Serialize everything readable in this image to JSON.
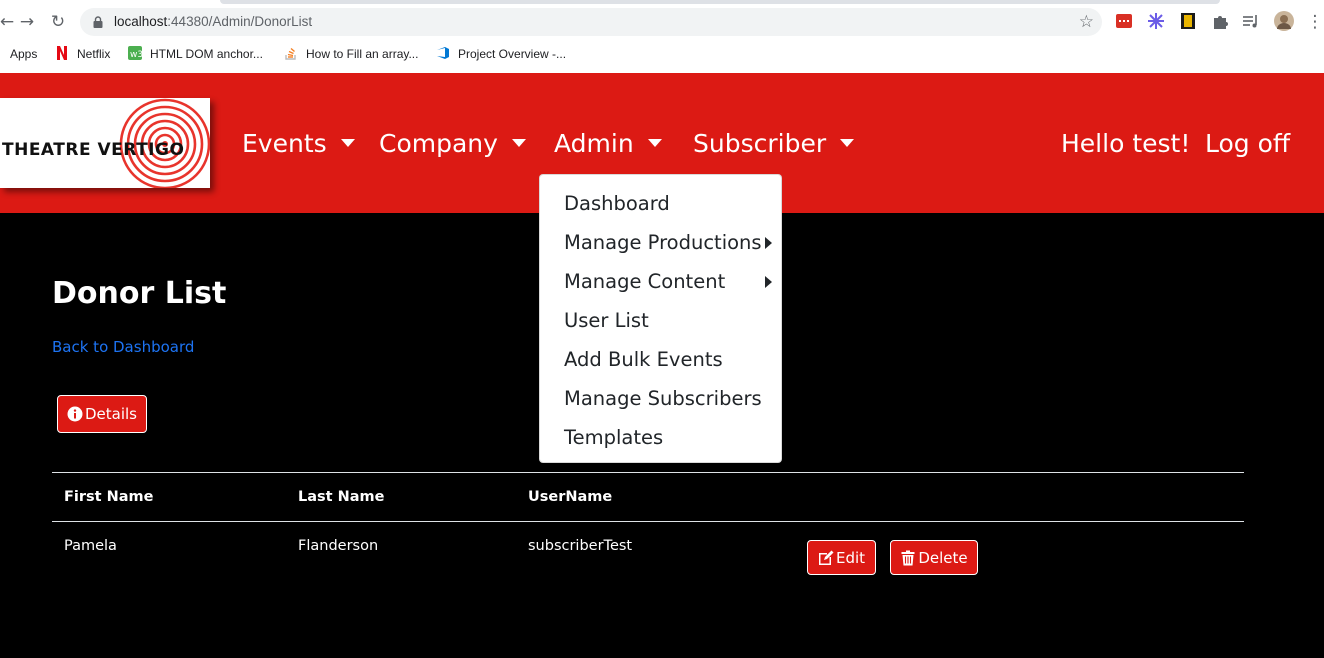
{
  "browser": {
    "url_host": "localhost",
    "url_path": ":44380/Admin/DonorList",
    "bookmarks": [
      "Apps",
      "Netflix",
      "HTML DOM anchor...",
      "How to Fill an array...",
      "Project Overview -..."
    ]
  },
  "navbar": {
    "logo_text": "THEATRE VERTIGO",
    "items": [
      "Events",
      "Company",
      "Admin",
      "Subscriber"
    ],
    "greeting": "Hello test!",
    "logoff": "Log off",
    "color": "#dc1a14"
  },
  "admin_menu": {
    "items": [
      {
        "label": "Dashboard",
        "submenu": false
      },
      {
        "label": "Manage Productions",
        "submenu": true
      },
      {
        "label": "Manage Content",
        "submenu": true
      },
      {
        "label": "User List",
        "submenu": false
      },
      {
        "label": "Add Bulk Events",
        "submenu": false
      },
      {
        "label": "Manage Subscribers",
        "submenu": false
      },
      {
        "label": "Templates",
        "submenu": false
      }
    ]
  },
  "page": {
    "title": "Donor List",
    "back_link": "Back to Dashboard",
    "details_button": "Details"
  },
  "table": {
    "headers": [
      "First Name",
      "Last Name",
      "UserName"
    ],
    "rows": [
      {
        "first": "Pamela",
        "last": "Flanderson",
        "username": "subscriberTest",
        "edit": "Edit",
        "delete": "Delete"
      }
    ]
  }
}
